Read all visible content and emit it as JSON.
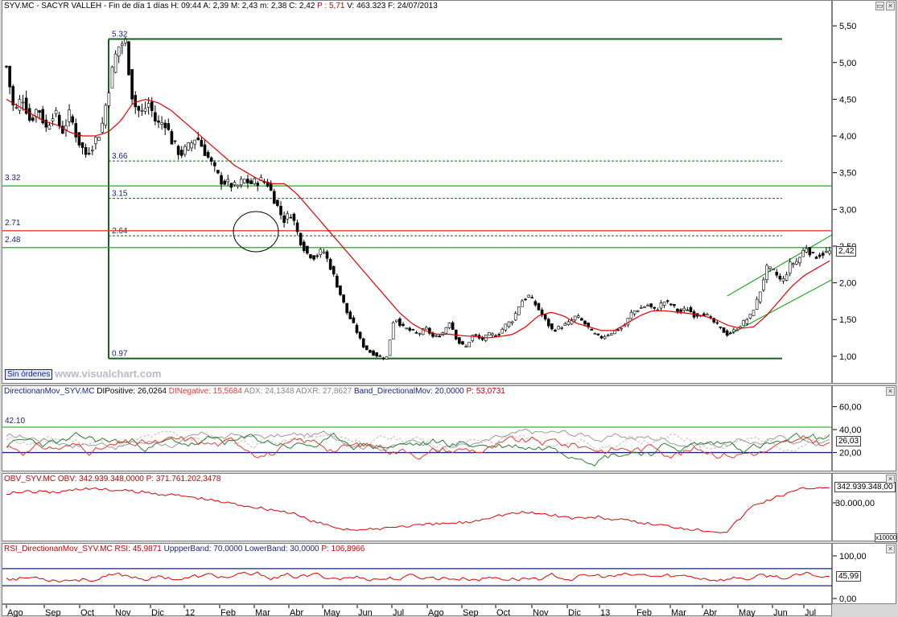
{
  "price_header": {
    "symbol": "SYV.MC - SACYR VALLEH",
    "period": "Fin de día 1 días",
    "high": "H: 09:44",
    "low_field": "A: 2,39",
    "max": "M: 2,43",
    "min": "m: 2,38",
    "close": "C: 2,42",
    "pct": "P : 5,71",
    "volume": "V: 463.323",
    "date": "F: 24/07/2013"
  },
  "dm_header": {
    "name": "DirectionanMov_SYV.MC",
    "dip": "DIPositive: 26,0264",
    "din": "DINegative: 15,5684",
    "adx": "ADX: 24,1348",
    "adxr": "ADXR: 27,8627",
    "band": "Band_DirectionalMov: 20,0000",
    "p": "P: 53,0731"
  },
  "obv_header": {
    "name": "OBV_SYV.MC",
    "obv": "OBV: 342.939.348,0000",
    "p": "P: 371.761.202,3478"
  },
  "rsi_header": {
    "name": "RSI_DirectionanMov_SYV.MC",
    "rsi": "RSI: 45,9871",
    "upper": "UppperBand: 70,0000",
    "lower": "LowerBand: 30,0000",
    "p": "P: 106,8966"
  },
  "badges": {
    "price": "2,42",
    "dm": "26,03",
    "obv": "342.939.348,00",
    "rsi": "45,99"
  },
  "sin_ordenes": "Sin órdenes",
  "watermark": "www.visualchart.com",
  "obv_scale": "x10000",
  "colors": {
    "candles": "#000000",
    "ma": "#e00000",
    "green": "#00c000",
    "navy": "#1a237e",
    "dip": "#2e7d32",
    "din": "#e53935"
  },
  "chart_data": [
    {
      "type": "candlestick",
      "title": "SYV.MC - SACYR VALLEH",
      "ylim": [
        0.9,
        5.6
      ],
      "y_ticks": [
        "1,00",
        "1,50",
        "2,00",
        "2,50",
        "3,00",
        "3,50",
        "4,00",
        "4,50",
        "5,00",
        "5,50"
      ],
      "x_labels": [
        "Ago",
        "Sep",
        "Oct",
        "Nov",
        "Dic",
        "12",
        "Feb",
        "Mar",
        "Abr",
        "May",
        "Jun",
        "Jul",
        "Ago",
        "Sep",
        "Oct",
        "Nov",
        "Dic",
        "13",
        "Feb",
        "Mar",
        "Abr",
        "May",
        "Jun",
        "Jul"
      ],
      "close_path": [
        4.95,
        4.3,
        4.55,
        4.2,
        4.4,
        4.1,
        4.35,
        4.05,
        4.3,
        3.95,
        3.75,
        3.9,
        4.1,
        4.7,
        5.2,
        5.3,
        4.45,
        4.3,
        4.45,
        4.15,
        4.2,
        3.9,
        3.75,
        3.85,
        4.0,
        3.8,
        3.6,
        3.4,
        3.35,
        3.3,
        3.4,
        3.35,
        3.4,
        3.35,
        3.1,
        2.85,
        2.95,
        2.6,
        2.4,
        2.35,
        2.45,
        2.2,
        1.9,
        1.6,
        1.4,
        1.15,
        1.05,
        1.0,
        0.97,
        1.55,
        1.4,
        1.35,
        1.3,
        1.38,
        1.25,
        1.3,
        1.48,
        1.2,
        1.12,
        1.3,
        1.22,
        1.3,
        1.28,
        1.42,
        1.5,
        1.75,
        1.82,
        1.68,
        1.5,
        1.35,
        1.4,
        1.45,
        1.55,
        1.45,
        1.32,
        1.25,
        1.3,
        1.35,
        1.4,
        1.6,
        1.65,
        1.7,
        1.62,
        1.75,
        1.7,
        1.6,
        1.65,
        1.55,
        1.6,
        1.5,
        1.4,
        1.3,
        1.35,
        1.45,
        1.55,
        1.8,
        2.2,
        2.15,
        2.0,
        2.25,
        2.3,
        2.5,
        2.35,
        2.4,
        2.42
      ],
      "ma_path": [
        4.5,
        4.4,
        4.3,
        4.2,
        4.15,
        4.05,
        4.0,
        4.0,
        4.05,
        4.2,
        4.45,
        4.5,
        4.45,
        4.35,
        4.2,
        4.05,
        3.9,
        3.75,
        3.6,
        3.5,
        3.4,
        3.35,
        3.35,
        3.2,
        3.0,
        2.8,
        2.6,
        2.4,
        2.2,
        2.0,
        1.8,
        1.6,
        1.45,
        1.35,
        1.3,
        1.3,
        1.28,
        1.27,
        1.25,
        1.27,
        1.3,
        1.4,
        1.55,
        1.6,
        1.55,
        1.45,
        1.4,
        1.35,
        1.35,
        1.45,
        1.55,
        1.62,
        1.62,
        1.6,
        1.58,
        1.55,
        1.5,
        1.42,
        1.38,
        1.4,
        1.55,
        1.75,
        1.95,
        2.1,
        2.2,
        2.3
      ],
      "fib_levels": [
        {
          "label": "5.32",
          "value": 5.32
        },
        {
          "label": "3.66",
          "value": 3.66
        },
        {
          "label": "3.15",
          "value": 3.15
        },
        {
          "label": "2.64",
          "value": 2.64
        },
        {
          "label": "0.97",
          "value": 0.97
        }
      ],
      "horizontal_lines": [
        {
          "label": "3.32",
          "value": 3.32,
          "color": "green"
        },
        {
          "label": "2.71",
          "value": 2.71,
          "color": "red"
        },
        {
          "label": "2.48",
          "value": 2.48,
          "color": "green"
        }
      ],
      "channel_upper": [
        [
          1.82,
          2.66
        ]
      ],
      "channel_lower": [
        [
          1.28,
          2.05
        ]
      ],
      "last_value": 2.42
    },
    {
      "type": "line",
      "title": "DirectionanMov_SYV.MC",
      "ylim": [
        5,
        68
      ],
      "y_ticks": [
        "20,00",
        "40,00",
        "60,00"
      ],
      "band_label": "42.10",
      "band_value": 42.1,
      "lower_value": 20,
      "last_value": 26.03
    },
    {
      "type": "line",
      "title": "OBV_SYV.MC",
      "y_ticks": [
        "30.000,00"
      ],
      "last_value": "342.939.348,00"
    },
    {
      "type": "line",
      "title": "RSI_DirectionanMov_SYV.MC",
      "ylim": [
        0,
        100
      ],
      "y_ticks": [
        "100,00",
        "0,00"
      ],
      "upper": 70,
      "lower": 30,
      "last_value": 45.99
    }
  ]
}
